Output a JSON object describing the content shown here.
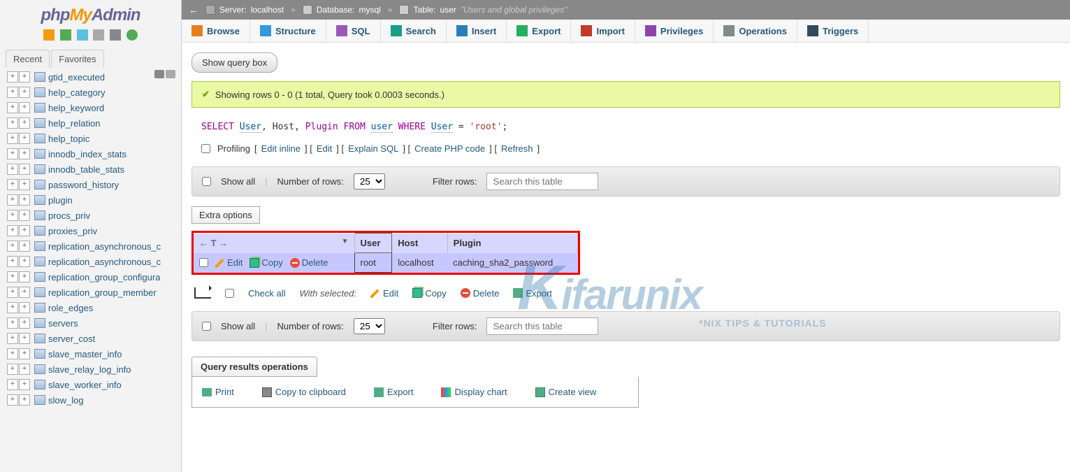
{
  "logo": {
    "php": "php",
    "my": "My",
    "admin": "Admin"
  },
  "nav_tabs": {
    "recent": "Recent",
    "favorites": "Favorites"
  },
  "tree": [
    "gtid_executed",
    "help_category",
    "help_keyword",
    "help_relation",
    "help_topic",
    "innodb_index_stats",
    "innodb_table_stats",
    "password_history",
    "plugin",
    "procs_priv",
    "proxies_priv",
    "replication_asynchronous_c",
    "replication_asynchronous_c",
    "replication_group_configura",
    "replication_group_member",
    "role_edges",
    "servers",
    "server_cost",
    "slave_master_info",
    "slave_relay_log_info",
    "slave_worker_info",
    "slow_log"
  ],
  "breadcrumb": {
    "server_label": "Server:",
    "server": "localhost",
    "db_label": "Database:",
    "db": "mysql",
    "table_label": "Table:",
    "table": "user",
    "desc": "\"Users and global privileges\""
  },
  "menu": [
    "Browse",
    "Structure",
    "SQL",
    "Search",
    "Insert",
    "Export",
    "Import",
    "Privileges",
    "Operations",
    "Triggers"
  ],
  "buttons": {
    "show_query": "Show query box",
    "extra_options": "Extra options"
  },
  "success_msg": "Showing rows 0 - 0 (1 total, Query took 0.0003 seconds.)",
  "sql": {
    "select": "SELECT",
    "user": "User",
    "host": ", Host, ",
    "plugin": "Plugin",
    "from": " FROM ",
    "table": "user",
    "where": " WHERE ",
    "user2": "User",
    "eq": " = ",
    "val": "'root'",
    "end": ";"
  },
  "actions": {
    "profiling": "Profiling",
    "edit_inline": "Edit inline",
    "edit": "Edit",
    "explain": "Explain SQL",
    "create_php": "Create PHP code",
    "refresh": "Refresh"
  },
  "controls": {
    "show_all": "Show all",
    "num_rows": "Number of rows:",
    "rows_value": "25",
    "filter": "Filter rows:",
    "search_placeholder": "Search this table"
  },
  "columns": {
    "user": "User",
    "host": "Host",
    "plugin": "Plugin"
  },
  "row": {
    "edit": "Edit",
    "copy": "Copy",
    "delete": "Delete",
    "user": "root",
    "host": "localhost",
    "plugin": "caching_sha2_password"
  },
  "bulk": {
    "check_all": "Check all",
    "with_selected": "With selected:",
    "edit": "Edit",
    "copy": "Copy",
    "delete": "Delete",
    "export": "Export"
  },
  "panel": {
    "title": "Query results operations",
    "print": "Print",
    "copy_clip": "Copy to clipboard",
    "export": "Export",
    "chart": "Display chart",
    "view": "Create view"
  },
  "watermark": {
    "brand": "Kifarunix",
    "sub": "*NIX TIPS & TUTORIALS"
  }
}
